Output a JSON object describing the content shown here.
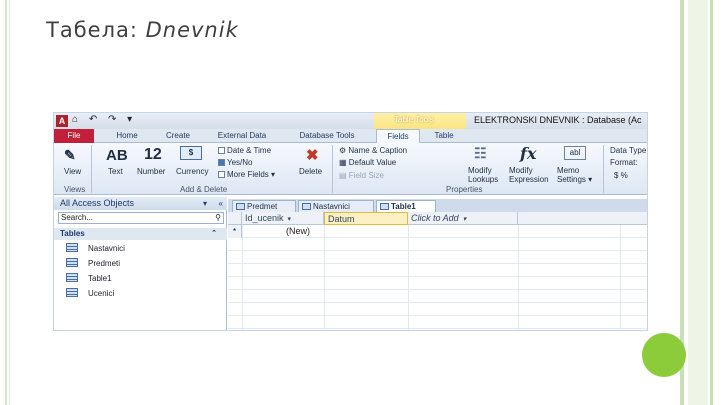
{
  "slide": {
    "title_plain": "Табела: ",
    "title_italic": "Dnevnik"
  },
  "window": {
    "app_icon": "A",
    "quick_access": "⌂ ↶ ↷ ▾",
    "context_tools_label": "Table Tools",
    "title": "ELEKTRONSKI DNEVNIK : Database (Ac"
  },
  "ribbon_tabs": [
    "File",
    "Home",
    "Create",
    "External Data",
    "Database Tools",
    "Fields",
    "Table"
  ],
  "ribbon": {
    "view_label": "View",
    "views_group": "Views",
    "text_label": "Text",
    "text_icon": "AB",
    "number_label": "Number",
    "number_icon": "12",
    "currency_label": "Currency",
    "date_time": "Date & Time",
    "yes_no": "Yes/No",
    "more_fields": "More Fields ▾",
    "delete_label": "Delete",
    "add_delete_group": "Add & Delete",
    "name_caption": "Name & Caption",
    "default_value": "Default Value",
    "field_size": "Field Size",
    "modify_lookups": [
      "Modify",
      "Lookups"
    ],
    "modify_expression": [
      "Modify",
      "Expression"
    ],
    "memo_settings": [
      "Memo",
      "Settings ▾"
    ],
    "properties_group": "Properties",
    "data_type": "Data Type:",
    "format": "Format:",
    "format_symbols": "$   %"
  },
  "nav_pane": {
    "header": "All Access Objects",
    "search_placeholder": "Search...",
    "section": "Tables",
    "items": [
      "Nastavnici",
      "Predmeti",
      "Table1",
      "Ucenici"
    ]
  },
  "doc_tabs": [
    "Predmet",
    "Nastavnici",
    "Table1"
  ],
  "grid": {
    "columns": [
      "Id_ucenik",
      "Datum",
      "Click to Add"
    ],
    "new_row_marker": "*",
    "new_row_value": "(New)"
  }
}
